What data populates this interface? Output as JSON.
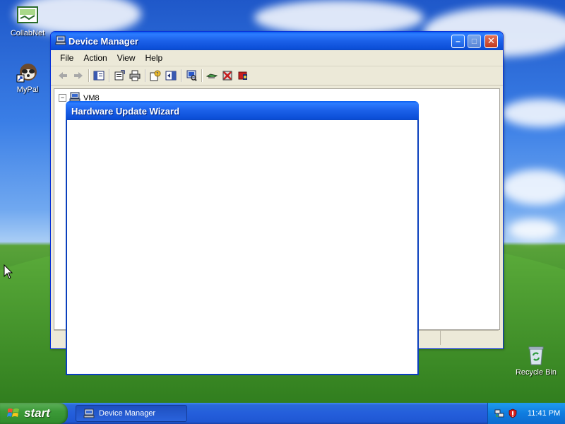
{
  "desktop": {
    "icons": [
      {
        "label": "CollabNet",
        "icon": "collabnet-icon"
      },
      {
        "label": "MyPal",
        "icon": "mypal-shortcut-icon"
      },
      {
        "label": "Recycle Bin",
        "icon": "recycle-bin-icon"
      }
    ]
  },
  "device_manager": {
    "title": "Device Manager",
    "menu": [
      "File",
      "Action",
      "View",
      "Help"
    ],
    "tree_root": "VM8"
  },
  "wizard": {
    "title": "Hardware Update Wizard"
  },
  "taskbar": {
    "start_label": "start",
    "task_label": "Device Manager",
    "clock": "11:41 PM"
  },
  "colors": {
    "titlebar_blue": "#0c4fd8",
    "taskbar_blue": "#245edb",
    "start_green": "#3c9a38",
    "window_face": "#ece9d8"
  }
}
